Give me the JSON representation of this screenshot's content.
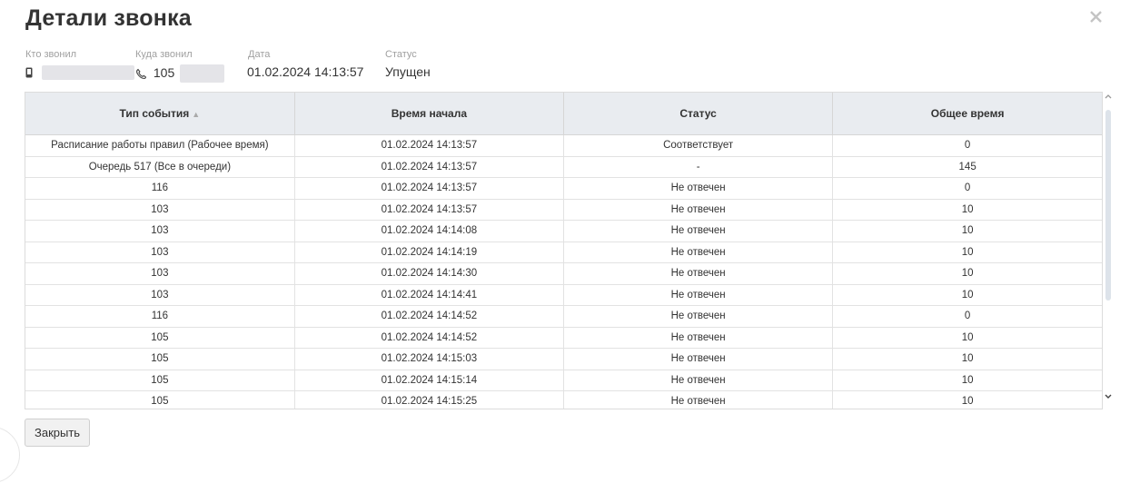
{
  "dialog": {
    "title": "Детали звонка",
    "close_button_label": "Закрыть"
  },
  "info": {
    "caller_label": "Кто звонил",
    "callee_label": "Куда звонил",
    "callee_value": "105",
    "date_label": "Дата",
    "date_value": "01.02.2024 14:13:57",
    "status_label": "Статус",
    "status_value": "Упущен"
  },
  "table": {
    "columns": [
      "Тип события",
      "Время начала",
      "Статус",
      "Общее время"
    ],
    "sorted_column": "Тип события",
    "sort_direction": "asc",
    "rows": [
      [
        "Расписание работы правил (Рабочее время)",
        "01.02.2024 14:13:57",
        "Соответствует",
        "0"
      ],
      [
        "Очередь 517 (Все в очереди)",
        "01.02.2024 14:13:57",
        "-",
        "145"
      ],
      [
        "116",
        "01.02.2024 14:13:57",
        "Не отвечен",
        "0"
      ],
      [
        "103",
        "01.02.2024 14:13:57",
        "Не отвечен",
        "10"
      ],
      [
        "103",
        "01.02.2024 14:14:08",
        "Не отвечен",
        "10"
      ],
      [
        "103",
        "01.02.2024 14:14:19",
        "Не отвечен",
        "10"
      ],
      [
        "103",
        "01.02.2024 14:14:30",
        "Не отвечен",
        "10"
      ],
      [
        "103",
        "01.02.2024 14:14:41",
        "Не отвечен",
        "10"
      ],
      [
        "116",
        "01.02.2024 14:14:52",
        "Не отвечен",
        "0"
      ],
      [
        "105",
        "01.02.2024 14:14:52",
        "Не отвечен",
        "10"
      ],
      [
        "105",
        "01.02.2024 14:15:03",
        "Не отвечен",
        "10"
      ],
      [
        "105",
        "01.02.2024 14:15:14",
        "Не отвечен",
        "10"
      ],
      [
        "105",
        "01.02.2024 14:15:25",
        "Не отвечен",
        "10"
      ]
    ]
  },
  "icons": {
    "close": "close-icon",
    "caller": "phone-device-icon",
    "callee": "phone-handset-icon",
    "sort": "sort-asc-icon"
  }
}
